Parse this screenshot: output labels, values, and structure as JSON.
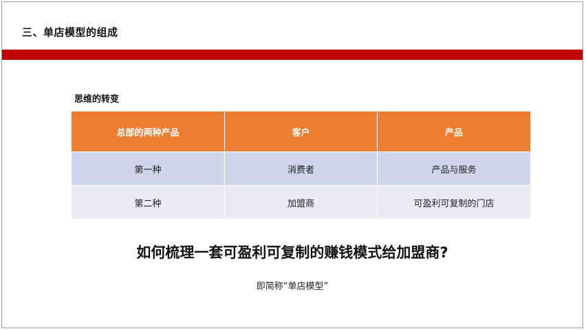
{
  "slide": {
    "title": "三、单店模型的组成",
    "section_heading": "思维的转变",
    "table": {
      "headers": [
        "总部的两种产品",
        "客户",
        "产品"
      ],
      "rows": [
        [
          "第一种",
          "消费者",
          "产品与服务"
        ],
        [
          "第二种",
          "加盟商",
          "可盈利可复制的门店"
        ]
      ]
    },
    "question": "如何梳理一套可盈利可复制的赚钱模式给加盟商?",
    "note": "即简称“单店模型”"
  },
  "colors": {
    "title_bar": "#c00000",
    "header_fill": "#ed7d31",
    "row_fill_1": "#cfd5ea",
    "row_fill_2": "#e9ebf5"
  }
}
